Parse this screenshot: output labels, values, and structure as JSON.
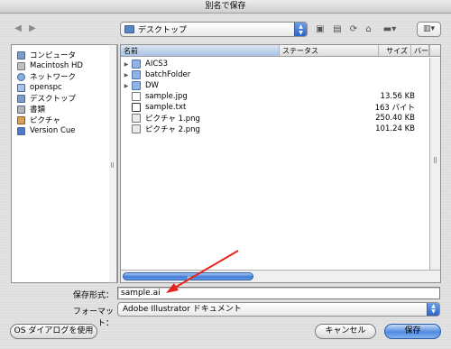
{
  "window": {
    "title": "別名で保存"
  },
  "toolbar": {
    "location": "デスクトップ",
    "back_icon": "back-arrow-icon",
    "forward_icon": "forward-arrow-icon",
    "tools": [
      "burn-icon",
      "new-folder-icon",
      "refresh-icon",
      "trash-icon",
      "action-menu-icon"
    ],
    "view_icon": "column-view-icon"
  },
  "sidebar": {
    "items": [
      {
        "label": "コンピュータ",
        "icon": "computer-icon"
      },
      {
        "label": "Macintosh HD",
        "icon": "hard-disk-icon"
      },
      {
        "label": "ネットワーク",
        "icon": "network-icon"
      },
      {
        "label": "openspc",
        "icon": "home-icon"
      },
      {
        "label": "デスクトップ",
        "icon": "desktop-icon"
      },
      {
        "label": "書類",
        "icon": "documents-icon"
      },
      {
        "label": "ピクチャ",
        "icon": "pictures-icon"
      },
      {
        "label": "Version Cue",
        "icon": "version-cue-icon"
      }
    ]
  },
  "browser": {
    "columns": {
      "name": "名前",
      "status": "ステータス",
      "size": "サイズ",
      "version": "バージョン"
    },
    "rows": [
      {
        "name": "AICS3",
        "size": "",
        "kind": "folder",
        "expandable": true
      },
      {
        "name": "batchFolder",
        "size": "",
        "kind": "folder",
        "expandable": true
      },
      {
        "name": "DW",
        "size": "",
        "kind": "folder",
        "expandable": true
      },
      {
        "name": "sample.jpg",
        "size": "13.56 KB",
        "kind": "doc",
        "expandable": false
      },
      {
        "name": "sample.txt",
        "size": "163 バイト",
        "kind": "txt",
        "expandable": false
      },
      {
        "name": "ピクチャ 1.png",
        "size": "250.40 KB",
        "kind": "img",
        "expandable": false
      },
      {
        "name": "ピクチャ 2.png",
        "size": "101.24 KB",
        "kind": "img",
        "expandable": false
      }
    ]
  },
  "form": {
    "save_as_label": "保存形式：",
    "save_as_value": "sample.ai",
    "format_label": "フォーマット：",
    "format_value": "Adobe Illustrator ドキュメント"
  },
  "buttons": {
    "os_dialog": "OS ダイアログを使用",
    "cancel": "キャンセル",
    "save": "保存"
  },
  "colors": {
    "accent": "#3f7ad6",
    "annotation_arrow": "#e8231b"
  }
}
